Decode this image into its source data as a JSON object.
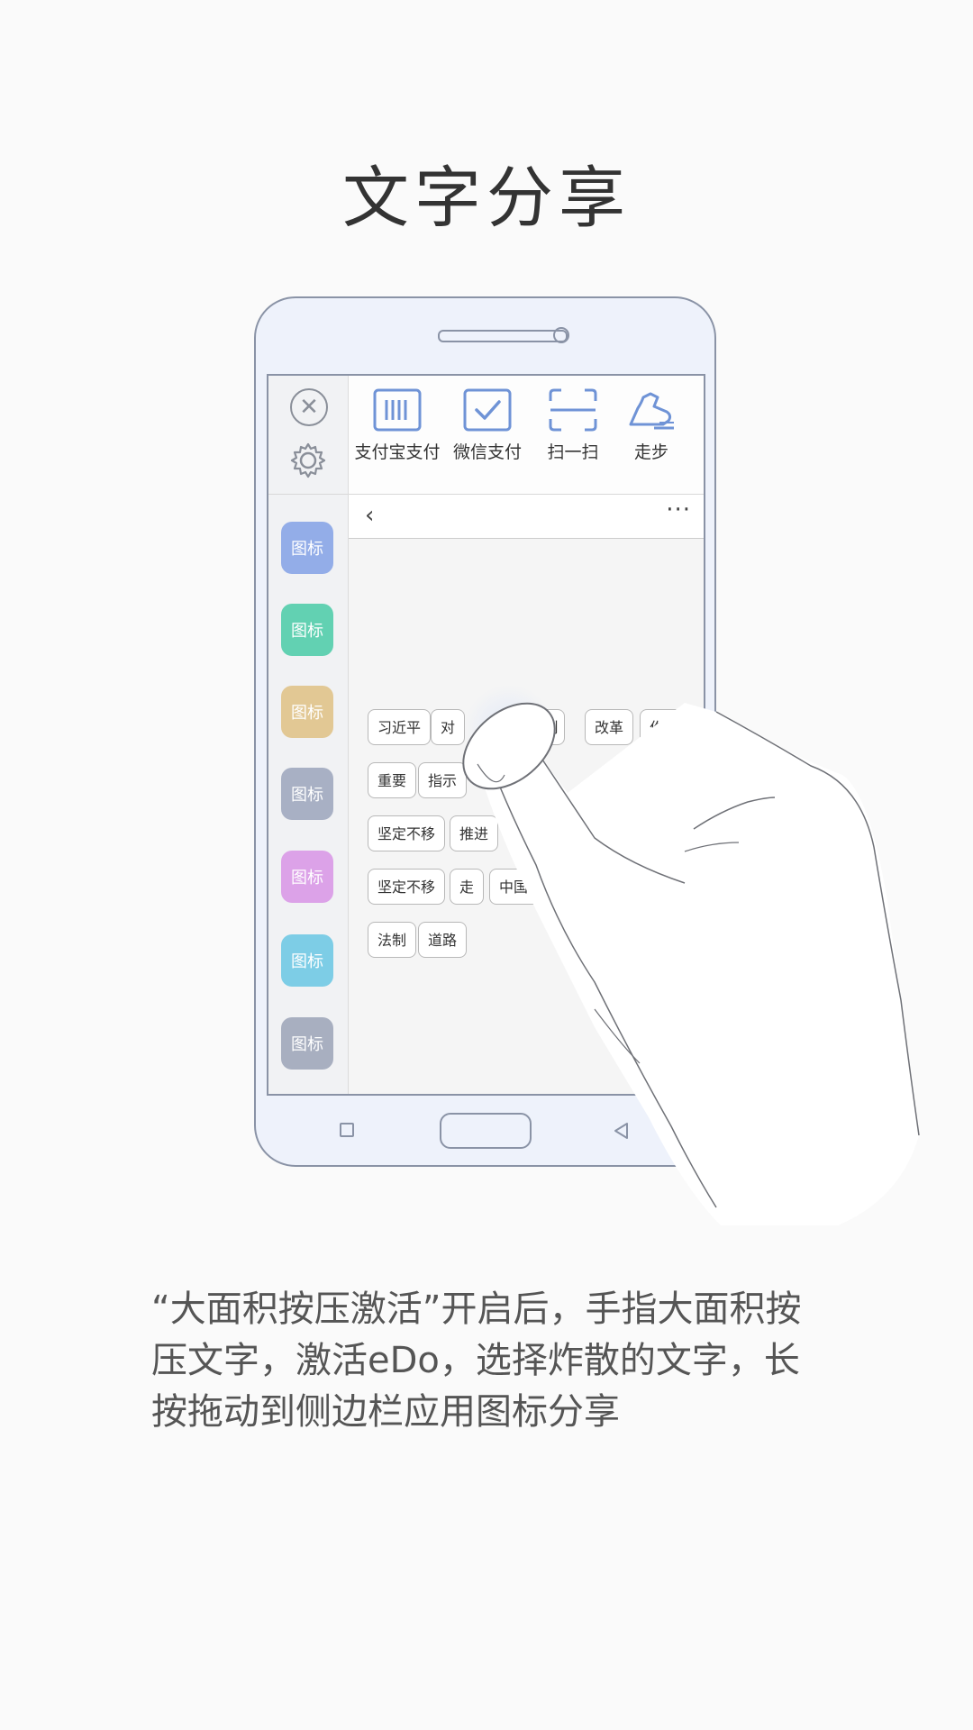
{
  "title": "文字分享",
  "sidebar": {
    "close_icon": "close-circle-icon",
    "settings_icon": "gear-icon",
    "tiles": [
      {
        "label": "图标",
        "color": "#93ade8"
      },
      {
        "label": "图标",
        "color": "#62d1b2"
      },
      {
        "label": "图标",
        "color": "#e2c894"
      },
      {
        "label": "图标",
        "color": "#a8b0c4"
      },
      {
        "label": "图标",
        "color": "#dca2e8"
      },
      {
        "label": "图标",
        "color": "#7dcde6"
      },
      {
        "label": "图标",
        "color": "#a8afc0"
      }
    ]
  },
  "toolbar": {
    "alipay": "支付宝支付",
    "wechat": "微信支付",
    "scan": "扫一扫",
    "walk": "走步",
    "accent": "#6f93d6"
  },
  "navbar": {
    "back": "‹",
    "more": "···"
  },
  "chips": [
    "习近平",
    "对",
    "…"
  ],
  "chips_all": {
    "r1": [
      "习近平",
      "对",
      "刂",
      "改革",
      "作出"
    ],
    "r2": [
      "重要",
      "指示"
    ],
    "r3": [
      "坚定不移",
      "推进"
    ],
    "r4": [
      "坚定不移",
      "走",
      "中国特"
    ],
    "r5": [
      "法制",
      "道路"
    ]
  },
  "description": "“大面积按压激活”开启后，手指大面积按压文字，激活eDo，选择炸散的文字，长按拖动到侧边栏应用图标分享"
}
